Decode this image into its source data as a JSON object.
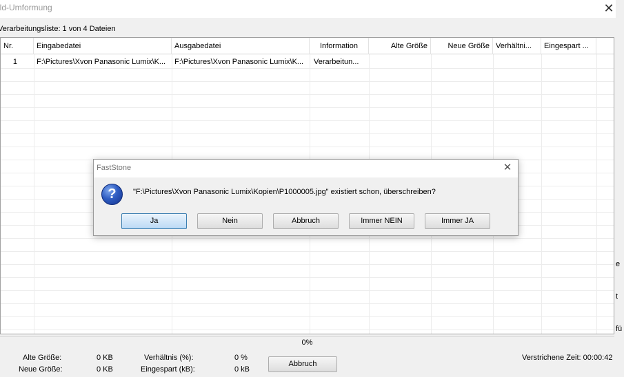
{
  "window": {
    "title": "ild-Umformung",
    "close_glyph": "✕"
  },
  "list": {
    "label": "Verarbeitungsliste: 1 von 4 Dateien",
    "columns": [
      "Nr.",
      "Eingabedatei",
      "Ausgabedatei",
      "Information",
      "Alte Größe",
      "Neue Größe",
      "Verhältni...",
      "Eingespart ..."
    ],
    "rows": [
      [
        "1",
        "F:\\Pictures\\Xvon Panasonic Lumix\\K...",
        "F:\\Pictures\\Xvon Panasonic Lumix\\K...",
        "Verarbeitun...",
        "",
        "",
        "",
        ""
      ]
    ]
  },
  "progress": {
    "percent_label": "0%",
    "value": 0
  },
  "stats": {
    "old_size_label": "Alte Größe:",
    "old_size_value": "0 KB",
    "new_size_label": "Neue Größe:",
    "new_size_value": "0 KB",
    "ratio_label": "Verhältnis (%):",
    "ratio_value": "0 %",
    "saved_label": "Eingespart (kB):",
    "saved_value": "0 kB",
    "elapsed": "Verstrichene Zeit: 00:00:42"
  },
  "cancel_button": "Abbruch",
  "dialog": {
    "title": "FastStone",
    "icon": "question-icon",
    "icon_glyph": "?",
    "close_glyph": "✕",
    "message": "\"F:\\Pictures\\Xvon Panasonic Lumix\\Kopien\\P1000005.jpg\" existiert schon, überschreiben?",
    "buttons": {
      "yes": "Ja",
      "no": "Nein",
      "cancel": "Abbruch",
      "always_no": "Immer NEIN",
      "always_yes": "Immer JA"
    }
  },
  "background_fragments": [
    "e",
    "t",
    "fü"
  ],
  "colors": {
    "default_button_border": "#3c7fb1",
    "question_icon": "#2f5dc2"
  }
}
